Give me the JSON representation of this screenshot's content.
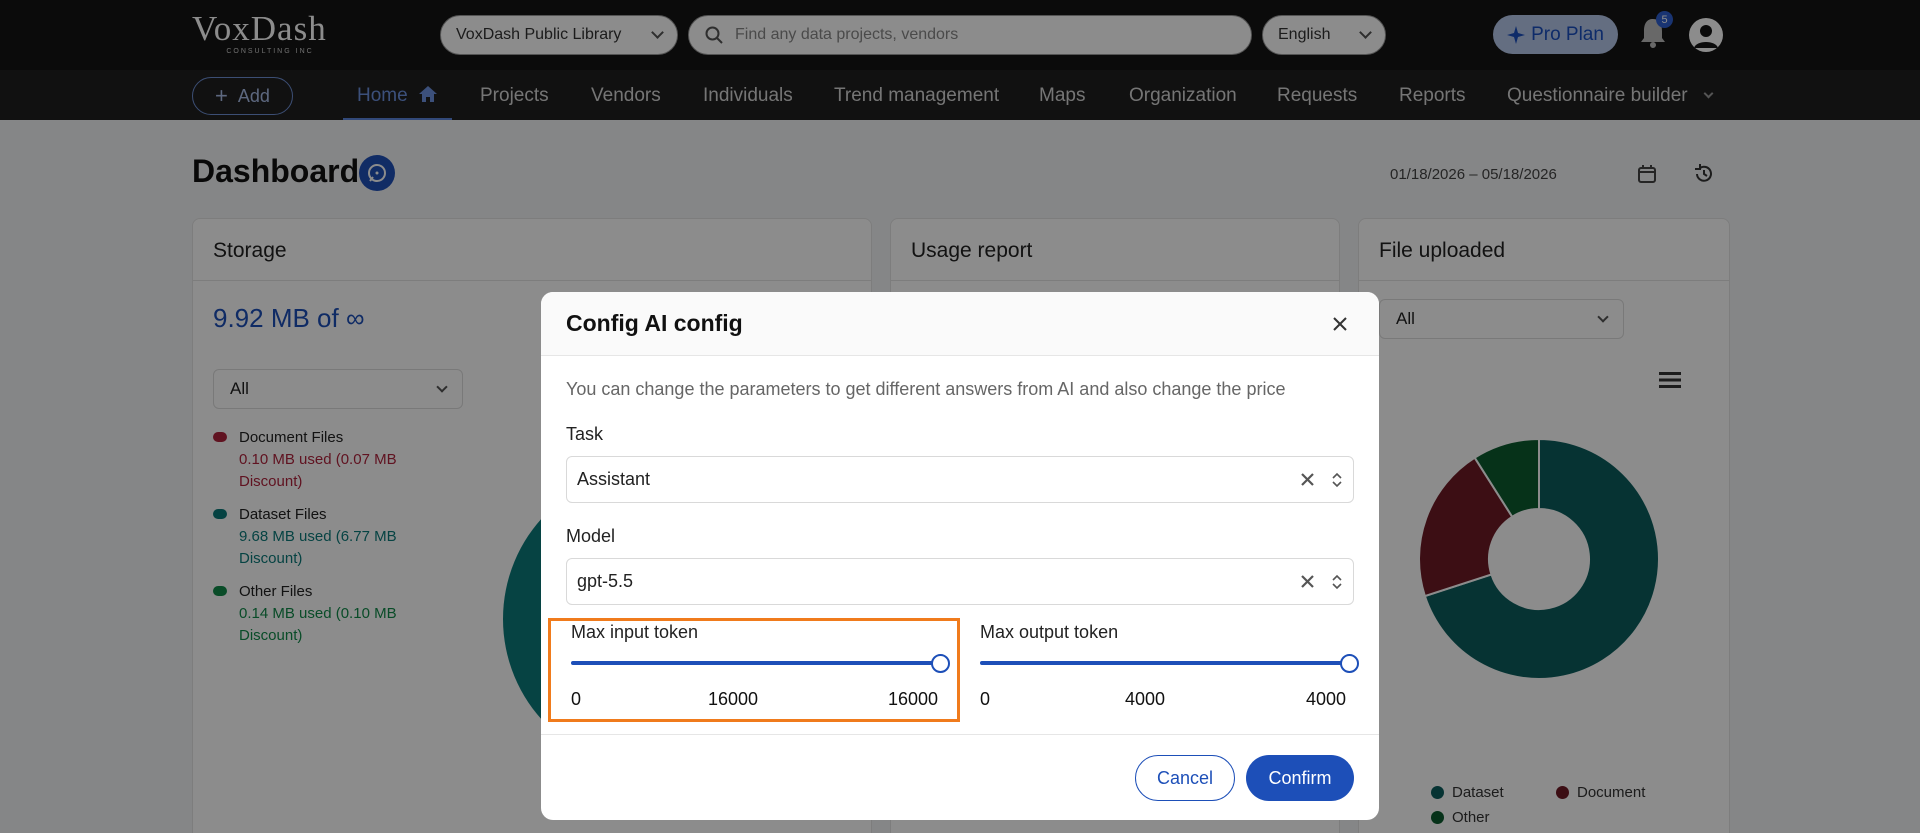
{
  "header": {
    "logo": "VoxDash",
    "logo_sub": "CONSULTING INC",
    "library_select": "VoxDash Public Library",
    "search_placeholder": "Find any data projects, vendors",
    "language": "English",
    "pro_plan": "Pro Plan",
    "notification_count": "5"
  },
  "nav": {
    "add": "Add",
    "items": [
      "Home",
      "Projects",
      "Vendors",
      "Individuals",
      "Trend management",
      "Maps",
      "Organization",
      "Requests",
      "Reports",
      "Questionnaire builder"
    ]
  },
  "dashboard": {
    "title": "Dashboard",
    "date_range": "01/18/2026 – 05/18/2026",
    "storage": {
      "title": "Storage",
      "total": "9.92 MB of ∞",
      "filter": "All",
      "legend": [
        {
          "name": "Document Files",
          "detail": "0.10 MB used (0.07 MB Discount)",
          "color": "#b0243d"
        },
        {
          "name": "Dataset Files",
          "detail": "9.68 MB used (6.77 MB Discount)",
          "color": "#0b7a7a"
        },
        {
          "name": "Other Files",
          "detail": "0.14 MB used (0.10 MB Discount)",
          "color": "#118a4a"
        }
      ]
    },
    "usage": {
      "title": "Usage report"
    },
    "files": {
      "title": "File uploaded",
      "filter": "All",
      "legend": [
        "Dataset",
        "Document",
        "Other"
      ]
    }
  },
  "modal": {
    "title": "Config AI config",
    "description": "You can change the parameters to get different answers from AI and also change the price",
    "task_label": "Task",
    "task_value": "Assistant",
    "model_label": "Model",
    "model_value": "gpt-5.5",
    "max_input": {
      "label": "Max input token",
      "min": "0",
      "max": "16000",
      "value": "16000",
      "fraction": 1.0
    },
    "max_output": {
      "label": "Max output token",
      "min": "0",
      "max": "4000",
      "value": "4000",
      "fraction": 1.0
    },
    "cancel": "Cancel",
    "confirm": "Confirm"
  },
  "colors": {
    "accent": "#1d4fb8",
    "dataset": "#0b5e5e",
    "document": "#6e1a26",
    "other": "#0c5b2e",
    "highlight": "#f07b1c"
  }
}
